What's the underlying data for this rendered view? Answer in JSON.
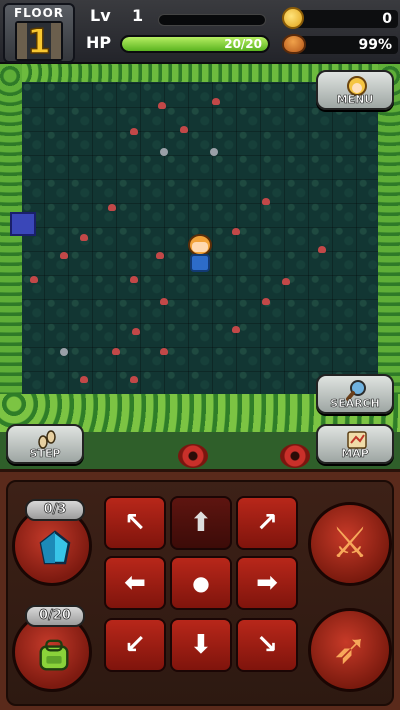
{
  "hud": {
    "floor_label": "FLOOR",
    "floor_number": "1",
    "level_label": "Lv",
    "level_value": "1",
    "hp_label": "HP",
    "hp_text": "20/20",
    "hp_fraction": 1.0,
    "coins": "0",
    "food_percent": "99%"
  },
  "map_buttons": {
    "menu": "MENU",
    "search": "SEARCH",
    "step": "STEP",
    "map": "MAP"
  },
  "controls": {
    "crystal_count": "0/3",
    "bag_count": "0/20",
    "dpad": {
      "up_left": "↖",
      "up": "⬆",
      "up_right": "↗",
      "left": "⬅",
      "center": "●",
      "right": "➡",
      "down_left": "↙",
      "down": "⬇",
      "down_right": "↘"
    },
    "sword_glyph": "⚔",
    "bow_glyph": "➶"
  },
  "colors": {
    "hp_bar": "#6cc62a",
    "dpad_red": "#b8271a",
    "field_dark": "#123633",
    "hedge_green": "#5fae38"
  }
}
